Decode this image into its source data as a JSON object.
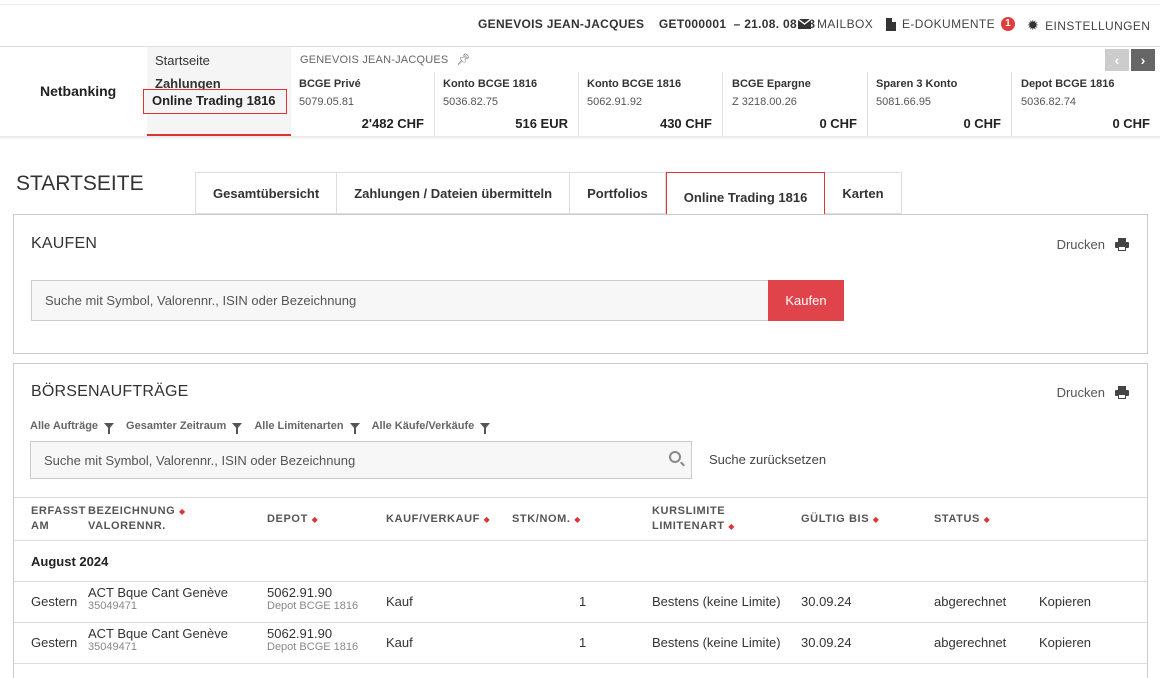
{
  "topbar": {
    "user": "GENEVOIS JEAN-JACQUES",
    "contract": "GET000001",
    "datetime": "– 21.08. 08:58",
    "mailbox": "MAILBOX",
    "edokumente": "E-DOKUMENTE",
    "edokumente_count": "1",
    "settings": "EINSTELLUNGEN"
  },
  "nav": {
    "brand": "Netbanking",
    "startseite": "Startseite",
    "zahlungen": "Zahlungen",
    "online_trading": "Online Trading 1816"
  },
  "accounts": {
    "owner": "GENEVOIS JEAN-JACQUES",
    "items": [
      {
        "name": "BCGE Privé",
        "number": "5079.05.81",
        "amount": "2'482 CHF"
      },
      {
        "name": "Konto BCGE 1816",
        "number": "5036.82.75",
        "amount": "516 EUR"
      },
      {
        "name": "Konto BCGE 1816",
        "number": "5062.91.92",
        "amount": "430 CHF"
      },
      {
        "name": "BCGE Epargne",
        "number": "Z 3218.00.26",
        "amount": "0 CHF"
      },
      {
        "name": "Sparen 3 Konto",
        "number": "5081.66.95",
        "amount": "0 CHF"
      },
      {
        "name": "Depot BCGE 1816",
        "number": "5036.82.74",
        "amount": "0 CHF"
      }
    ]
  },
  "page": {
    "title": "STARTSEITE",
    "tabs": [
      "Gesamtübersicht",
      "Zahlungen / Dateien übermitteln",
      "Portfolios",
      "Online Trading 1816",
      "Karten"
    ]
  },
  "kaufen": {
    "title": "KAUFEN",
    "print": "Drucken",
    "search_placeholder": "Suche mit Symbol, Valorennr., ISIN oder Bezeichnung",
    "button": "Kaufen"
  },
  "orders": {
    "title": "BÖRSENAUFTRÄGE",
    "print": "Drucken",
    "filters": [
      "Alle Aufträge",
      "Gesamter Zeitraum",
      "Alle Limitenarten",
      "Alle Käufe/Verkäufe"
    ],
    "search_placeholder": "Suche mit Symbol, Valorennr., ISIN oder Bezeichnung",
    "reset": "Suche zurücksetzen",
    "columns": {
      "erfasst1": "ERFASST",
      "erfasst2": "AM",
      "bez1": "BEZEICHNUNG",
      "bez2": "VALORENNR.",
      "depot": "DEPOT",
      "kv": "KAUF/VERKAUF",
      "stk": "STK/NOM.",
      "kurs1": "KURSLIMITE",
      "kurs2": "LIMITENART",
      "gueltig": "GÜLTIG BIS",
      "status": "STATUS"
    },
    "group": "August 2024",
    "rows": [
      {
        "date": "Gestern",
        "name": "ACT Bque Cant Genève",
        "valor": "35049471",
        "depot": "5062.91.90",
        "depot_name": "Depot BCGE 1816",
        "type": "Kauf",
        "qty": "1",
        "limit": "Bestens (keine Limite)",
        "valid": "30.09.24",
        "status": "abgerechnet",
        "action": "Kopieren"
      },
      {
        "date": "Gestern",
        "name": "ACT Bque Cant Genève",
        "valor": "35049471",
        "depot": "5062.91.90",
        "depot_name": "Depot BCGE 1816",
        "type": "Kauf",
        "qty": "1",
        "limit": "Bestens (keine Limite)",
        "valid": "30.09.24",
        "status": "abgerechnet",
        "action": "Kopieren"
      }
    ]
  }
}
